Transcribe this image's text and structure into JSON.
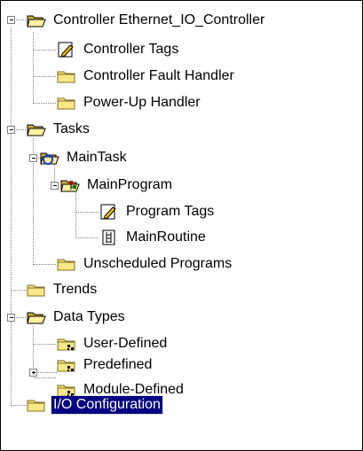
{
  "tree": {
    "items": [
      {
        "label": "Controller Ethernet_IO_Controller",
        "icon": "folder-open-icon",
        "expander": "minus"
      },
      {
        "label": "Controller Tags",
        "icon": "tags-icon"
      },
      {
        "label": "Controller Fault Handler",
        "icon": "folder-icon"
      },
      {
        "label": "Power-Up Handler",
        "icon": "folder-icon"
      },
      {
        "label": "Tasks",
        "icon": "folder-open-icon",
        "expander": "minus"
      },
      {
        "label": "MainTask",
        "icon": "task-icon",
        "expander": "minus"
      },
      {
        "label": "MainProgram",
        "icon": "program-icon",
        "expander": "minus"
      },
      {
        "label": "Program Tags",
        "icon": "tags-icon"
      },
      {
        "label": "MainRoutine",
        "icon": "routine-icon"
      },
      {
        "label": "Unscheduled Programs",
        "icon": "folder-icon"
      },
      {
        "label": "Trends",
        "icon": "folder-icon"
      },
      {
        "label": "Data Types",
        "icon": "folder-open-icon",
        "expander": "minus"
      },
      {
        "label": "User-Defined",
        "icon": "datatype-folder-icon"
      },
      {
        "label": "Predefined",
        "icon": "datatype-folder-icon",
        "expander": "plus"
      },
      {
        "label": "Module-Defined",
        "icon": "datatype-folder-icon"
      },
      {
        "label": "I/O Configuration",
        "icon": "folder-icon",
        "selected": true
      }
    ]
  }
}
